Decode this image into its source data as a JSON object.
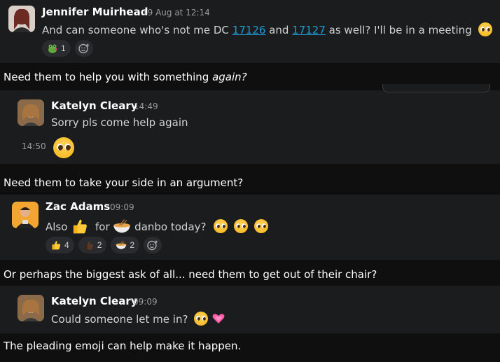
{
  "messages": [
    {
      "name": "Jennifer Muirhead",
      "time": "19 Aug at 12:14",
      "text_before": "And can someone who's not me DC ",
      "link1": "17126",
      "text_mid": " and ",
      "link2": "17127",
      "text_after": " as well? I'll be in a meeting",
      "reactions": [
        {
          "icon": "kiss-frog-emoji",
          "count": "1"
        }
      ]
    },
    {
      "name": "Katelyn Cleary",
      "time": "14:49",
      "text": "Sorry pls come help again",
      "followup_time": "14:50"
    },
    {
      "name": "Zac Adams",
      "time": "09:09",
      "text_also": "Also",
      "text_for": "for",
      "text_after": "danbo today?",
      "reactions": [
        {
          "icon": "thumbs-up-emoji",
          "count": "4"
        },
        {
          "icon": "thumbs-up-dark-emoji",
          "count": "2"
        },
        {
          "icon": "ramen-bowl-emoji",
          "count": "2"
        }
      ]
    },
    {
      "name": "Katelyn Cleary",
      "time": "09:09",
      "text": "Could someone let me in?"
    }
  ],
  "captions": {
    "c1_plain": "Need them to help you with something ",
    "c1_italic": "again?",
    "c2": "Need them to take your side in an argument?",
    "c3": "Or perhaps the biggest ask of all... need them to get out of their chair?",
    "c4": "The pleading emoji can help make it happen."
  },
  "colors": {
    "link": "#1d9bd1",
    "background": "#1b1c1e",
    "reaction": "#2a2b2e"
  }
}
